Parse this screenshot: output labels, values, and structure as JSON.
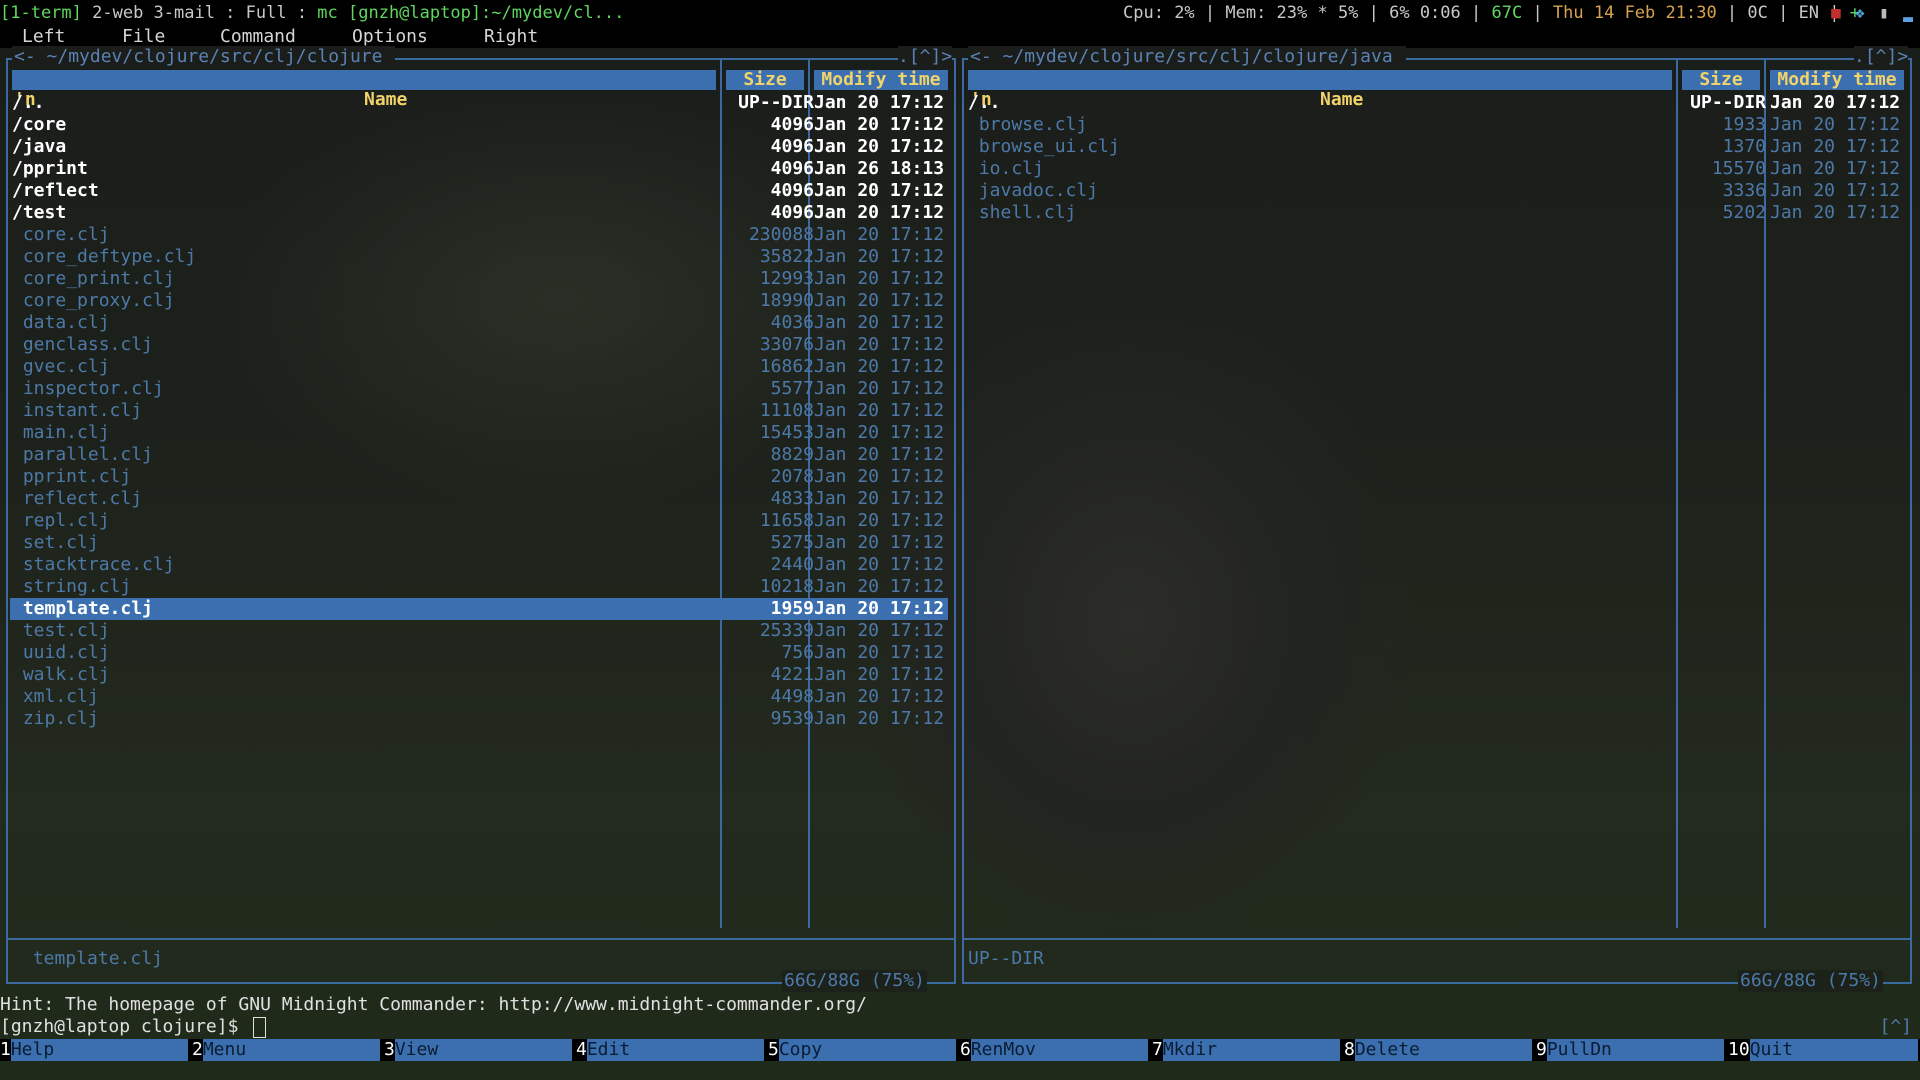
{
  "statusbar": {
    "workspace_active": "[1-term]",
    "workspaces_rest": " 2-web 3-mail : Full : ",
    "window_title": "mc [gnzh@laptop]:~/mydev/cl...",
    "cpu": "Cpu: 2% | Mem: 23% * 5% | 6% 0:06 | ",
    "temp": "67C",
    "sep1": " | ",
    "datetime": "Thu 14 Feb 21:30",
    "sep2": " | 0C | EN | ",
    "plus": "+",
    "icons": [
      "app-icon",
      "dropbox-icon",
      "battery-icon",
      "signal-icon"
    ],
    "colors": {
      "green": "#5fd75f",
      "orange": "#d7a24f",
      "gray": "#c8c8c8"
    }
  },
  "menu": {
    "left": "Left",
    "file": "File",
    "command": "Command",
    "options": "Options",
    "right": "Right"
  },
  "left_panel": {
    "title": "~/mydev/clojure/src/clj/clojure",
    "corner": ".[^]>",
    "corner_left": "<-",
    "headers": {
      "n": "'n",
      "name": "Name",
      "size": "Size",
      "mtime": "Modify time"
    },
    "rows": [
      {
        "name": "/..",
        "size": "UP--DIR",
        "time": "Jan 20 17:12",
        "kind": "dir"
      },
      {
        "name": "/core",
        "size": "4096",
        "time": "Jan 20 17:12",
        "kind": "dir"
      },
      {
        "name": "/java",
        "size": "4096",
        "time": "Jan 20 17:12",
        "kind": "dir"
      },
      {
        "name": "/pprint",
        "size": "4096",
        "time": "Jan 26 18:13",
        "kind": "dir"
      },
      {
        "name": "/reflect",
        "size": "4096",
        "time": "Jan 20 17:12",
        "kind": "dir"
      },
      {
        "name": "/test",
        "size": "4096",
        "time": "Jan 20 17:12",
        "kind": "dir"
      },
      {
        "name": " core.clj",
        "size": "230088",
        "time": "Jan 20 17:12",
        "kind": "file"
      },
      {
        "name": " core_deftype.clj",
        "size": "35822",
        "time": "Jan 20 17:12",
        "kind": "file"
      },
      {
        "name": " core_print.clj",
        "size": "12993",
        "time": "Jan 20 17:12",
        "kind": "file"
      },
      {
        "name": " core_proxy.clj",
        "size": "18990",
        "time": "Jan 20 17:12",
        "kind": "file"
      },
      {
        "name": " data.clj",
        "size": "4036",
        "time": "Jan 20 17:12",
        "kind": "file"
      },
      {
        "name": " genclass.clj",
        "size": "33076",
        "time": "Jan 20 17:12",
        "kind": "file"
      },
      {
        "name": " gvec.clj",
        "size": "16862",
        "time": "Jan 20 17:12",
        "kind": "file"
      },
      {
        "name": " inspector.clj",
        "size": "5577",
        "time": "Jan 20 17:12",
        "kind": "file"
      },
      {
        "name": " instant.clj",
        "size": "11108",
        "time": "Jan 20 17:12",
        "kind": "file"
      },
      {
        "name": " main.clj",
        "size": "15453",
        "time": "Jan 20 17:12",
        "kind": "file"
      },
      {
        "name": " parallel.clj",
        "size": "8829",
        "time": "Jan 20 17:12",
        "kind": "file"
      },
      {
        "name": " pprint.clj",
        "size": "2078",
        "time": "Jan 20 17:12",
        "kind": "file"
      },
      {
        "name": " reflect.clj",
        "size": "4833",
        "time": "Jan 20 17:12",
        "kind": "file"
      },
      {
        "name": " repl.clj",
        "size": "11658",
        "time": "Jan 20 17:12",
        "kind": "file"
      },
      {
        "name": " set.clj",
        "size": "5275",
        "time": "Jan 20 17:12",
        "kind": "file"
      },
      {
        "name": " stacktrace.clj",
        "size": "2440",
        "time": "Jan 20 17:12",
        "kind": "file"
      },
      {
        "name": " string.clj",
        "size": "10218",
        "time": "Jan 20 17:12",
        "kind": "file"
      },
      {
        "name": " template.clj",
        "size": "1959",
        "time": "Jan 20 17:12",
        "kind": "selected"
      },
      {
        "name": " test.clj",
        "size": "25339",
        "time": "Jan 20 17:12",
        "kind": "file"
      },
      {
        "name": " uuid.clj",
        "size": "756",
        "time": "Jan 20 17:12",
        "kind": "file"
      },
      {
        "name": " walk.clj",
        "size": "4221",
        "time": "Jan 20 17:12",
        "kind": "file"
      },
      {
        "name": " xml.clj",
        "size": "4498",
        "time": "Jan 20 17:12",
        "kind": "file"
      },
      {
        "name": " zip.clj",
        "size": "9539",
        "time": "Jan 20 17:12",
        "kind": "file"
      }
    ],
    "mini_status": " template.clj",
    "disk": "66G/88G (75%)"
  },
  "right_panel": {
    "title": "~/mydev/clojure/src/clj/clojure/java",
    "corner": ".[^]>",
    "corner_left": "<-",
    "headers": {
      "n": "'n",
      "name": "Name",
      "size": "Size",
      "mtime": "Modify time"
    },
    "rows": [
      {
        "name": "/..",
        "size": "UP--DIR",
        "time": "Jan 20 17:12",
        "kind": "dir"
      },
      {
        "name": " browse.clj",
        "size": "1933",
        "time": "Jan 20 17:12",
        "kind": "file"
      },
      {
        "name": " browse_ui.clj",
        "size": "1370",
        "time": "Jan 20 17:12",
        "kind": "file"
      },
      {
        "name": " io.clj",
        "size": "15570",
        "time": "Jan 20 17:12",
        "kind": "file"
      },
      {
        "name": " javadoc.clj",
        "size": "3336",
        "time": "Jan 20 17:12",
        "kind": "file"
      },
      {
        "name": " shell.clj",
        "size": "5202",
        "time": "Jan 20 17:12",
        "kind": "file"
      }
    ],
    "mini_status": "UP--DIR",
    "disk": "66G/88G (75%)"
  },
  "hint": "Hint: The homepage of GNU Midnight Commander: http://www.midnight-commander.org/",
  "prompt": "[gnzh@laptop clojure]$ ",
  "prompt_corner": "[^]",
  "fkeys": [
    {
      "num": "1",
      "label": "Help"
    },
    {
      "num": "2",
      "label": "Menu"
    },
    {
      "num": "3",
      "label": "View"
    },
    {
      "num": "4",
      "label": "Edit"
    },
    {
      "num": "5",
      "label": "Copy"
    },
    {
      "num": "6",
      "label": "RenMov"
    },
    {
      "num": "7",
      "label": "Mkdir"
    },
    {
      "num": "8",
      "label": "Delete"
    },
    {
      "num": "9",
      "label": "PullDn"
    },
    {
      "num": "10",
      "label": "Quit"
    }
  ]
}
